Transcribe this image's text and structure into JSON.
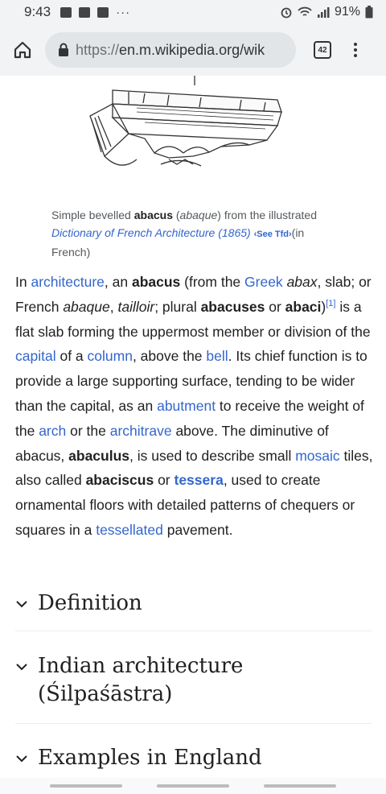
{
  "status_bar": {
    "time": "9:43",
    "battery": "91%",
    "more": "···"
  },
  "browser": {
    "url_scheme": "https://",
    "url_rest": "en.m.wikipedia.org/wik",
    "tab_count": "42"
  },
  "caption": {
    "prefix": "Simple bevelled ",
    "term": "abacus",
    "open": " (",
    "french": "abaque",
    "mid": ") from the illustrated ",
    "book": "Dictionary of French Architecture (1865)",
    "tfd": "‹See Tfd›",
    "suffix": "(in French)"
  },
  "article": {
    "p1": "In ",
    "l_architecture": "architecture",
    "p2": ", an ",
    "b_abacus": "abacus",
    "p3": " (from the ",
    "l_greek": "Greek",
    "p4": " ",
    "i_abax": "abax",
    "p5": ", slab; or French ",
    "i_abaque": "abaque",
    "p6": ", ",
    "i_tailloir": "tailloir",
    "p7": "; plural ",
    "b_abacuses": "abacuses",
    "p8": " or ",
    "b_abaci": "abaci",
    "p9": ")",
    "ref1": "[1]",
    "p10": " is a flat slab forming the uppermost member or division of the ",
    "l_capital": "capital",
    "p11": " of a ",
    "l_column": "column",
    "p12": ", above the ",
    "l_bell": "bell",
    "p13": ". Its chief function is to provide a large supporting surface, tending to be wider than the capital, as an ",
    "l_abutment": "abutment",
    "p14": " to receive the weight of the ",
    "l_arch": "arch",
    "p15": " or the ",
    "l_architrave": "architrave",
    "p16": " above. The diminutive of abacus, ",
    "b_abaculus": "abaculus",
    "p17": ", is used to describe small ",
    "l_mosaic": "mosaic",
    "p18": " tiles, also called ",
    "b_abaciscus": "abaciscus",
    "p19": " or ",
    "l_tessera": "tessera",
    "p20": ", used to create ornamental floors with detailed patterns of chequers or squares in a ",
    "l_tessellated": "tessellated",
    "p21": " pavement."
  },
  "sections": [
    {
      "title": "Definition"
    },
    {
      "title": "Indian architecture (Śilpaśāstra)"
    },
    {
      "title": "Examples in England"
    }
  ],
  "colors": {
    "link": "#3366cc",
    "text": "#202122",
    "chrome": "#f1f3f4"
  }
}
